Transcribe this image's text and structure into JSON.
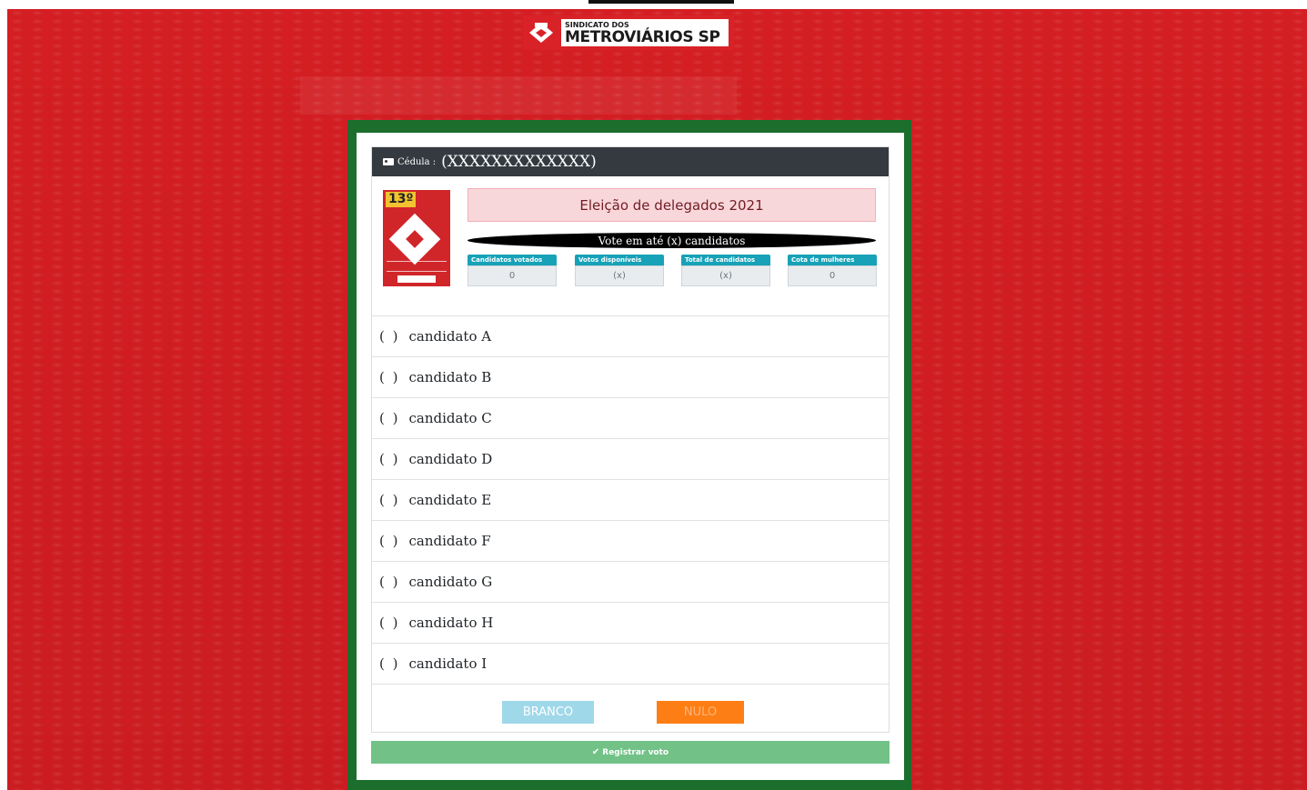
{
  "header": {
    "logo_small": "SINDICATO DOS",
    "logo_big": "METROVIÁRIOS SP"
  },
  "ballot": {
    "cedula_label": "Cédula :",
    "cedula_value": "(XXXXXXXXXXXXX)",
    "poster_number": "13º",
    "election_title": "Eleição de delegados 2021",
    "instruction": "Vote em até (x) candidatos",
    "stats": [
      {
        "label": "Candidatos votados",
        "value": "0"
      },
      {
        "label": "Votos disponíveis",
        "value": "(x)"
      },
      {
        "label": "Total de candidatos",
        "value": "(x)"
      },
      {
        "label": "Cota de mulheres",
        "value": "0"
      }
    ],
    "candidates": [
      {
        "mark": "( )",
        "name": "candidato A"
      },
      {
        "mark": "( )",
        "name": "candidato B"
      },
      {
        "mark": "( )",
        "name": "candidato C"
      },
      {
        "mark": "( )",
        "name": "candidato D"
      },
      {
        "mark": "( )",
        "name": "candidato E"
      },
      {
        "mark": "( )",
        "name": "candidato F"
      },
      {
        "mark": "( )",
        "name": "candidato G"
      },
      {
        "mark": "( )",
        "name": "candidato H"
      },
      {
        "mark": "( )",
        "name": "candidato I"
      }
    ],
    "blank_label": "BRANCO",
    "null_label": "NULO",
    "submit_label": "Registrar voto"
  }
}
